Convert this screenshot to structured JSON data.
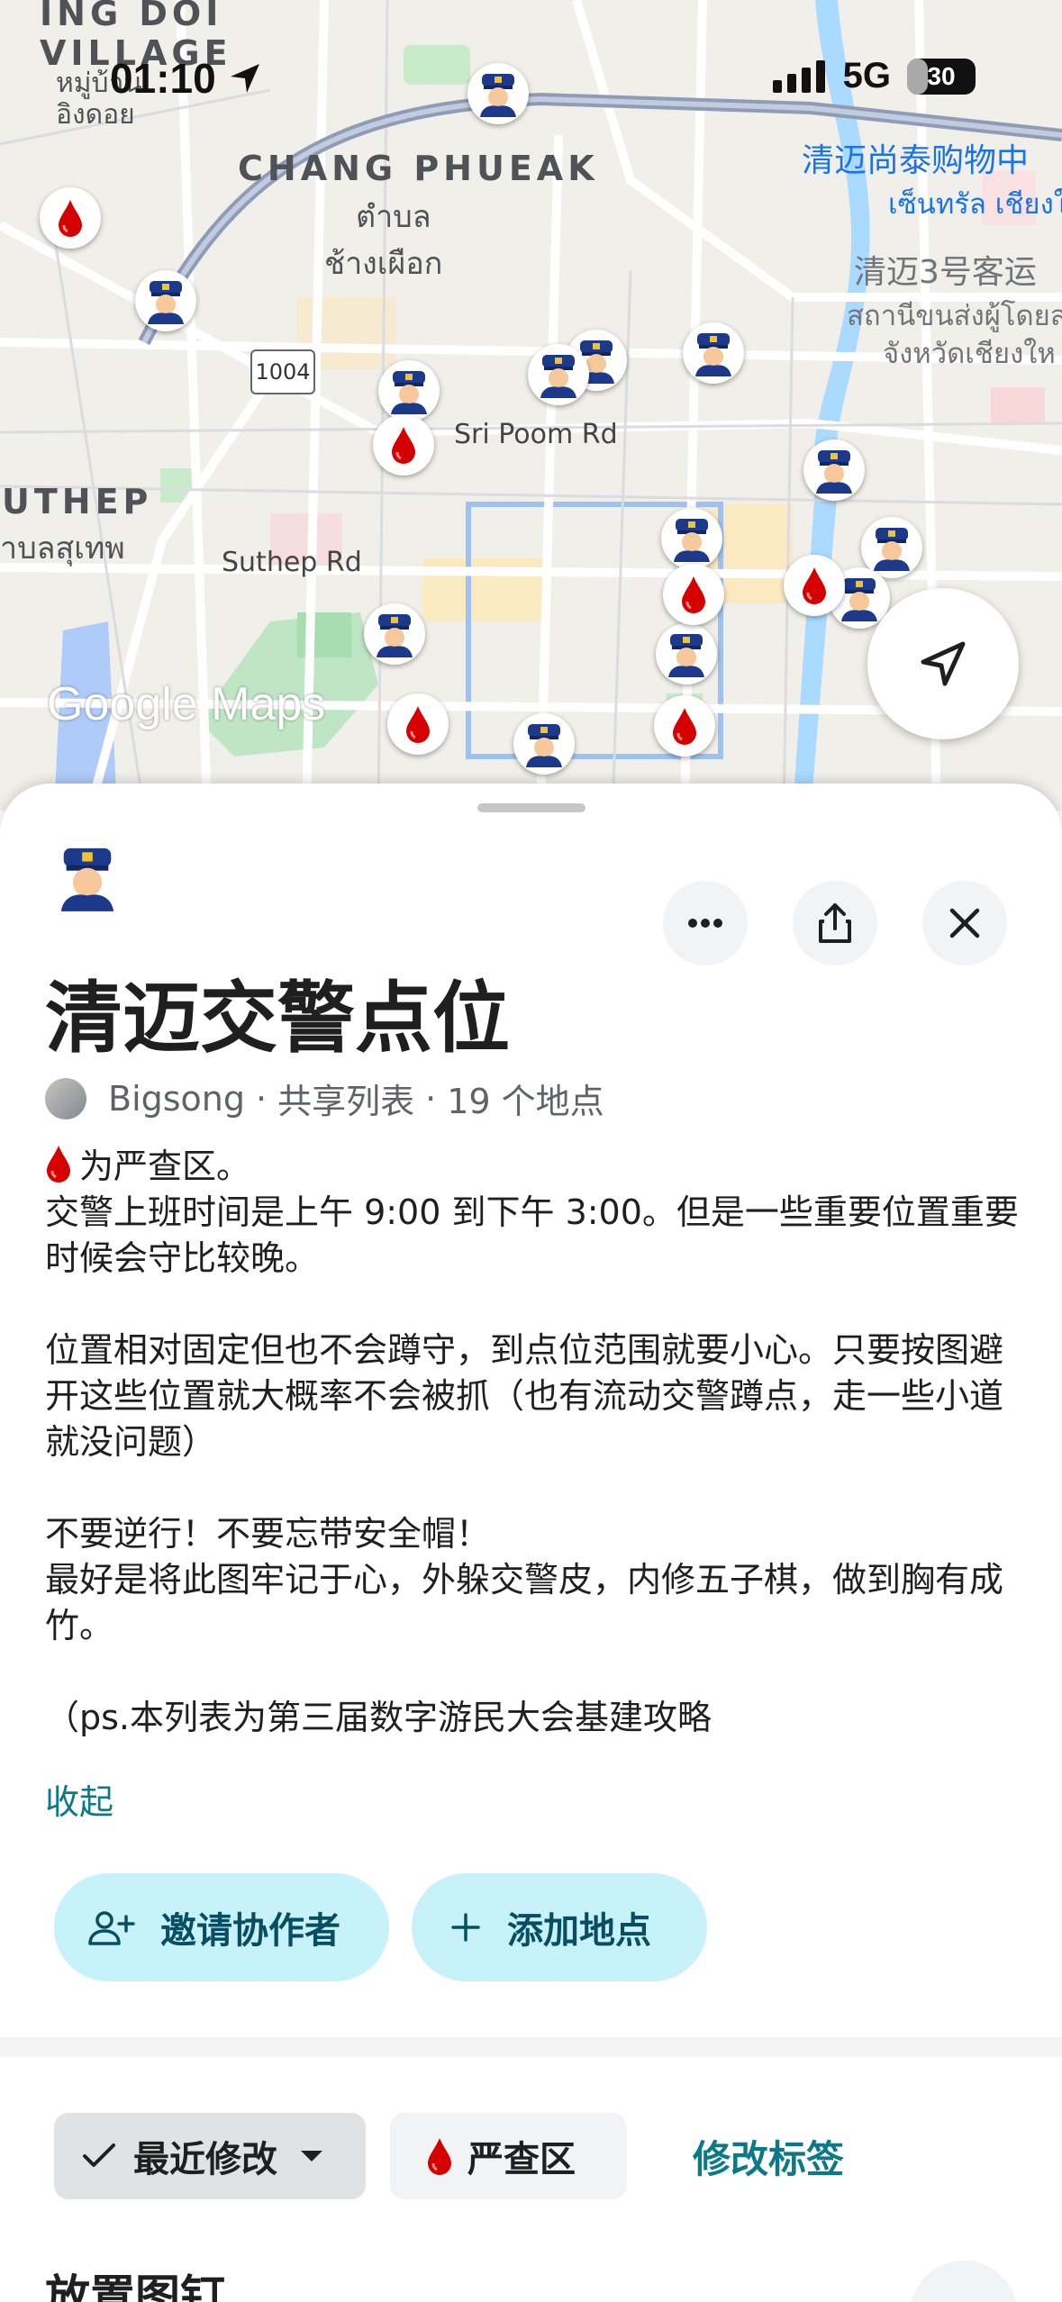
{
  "status_bar": {
    "time": "01:10",
    "network": "5G",
    "battery": "30",
    "battery_fraction": 0.3
  },
  "map": {
    "labels": {
      "village_en_1": "ING DOI",
      "village_en_2": "VILLAGE",
      "village_thai_1": "หมู่บ้าน",
      "village_thai_2": "อิงดอย",
      "district_chang_phueak": "CHANG PHUEAK",
      "chang_phueak_thai_1": "ตำบล",
      "chang_phueak_thai_2": "ช้างเผือก",
      "district_suthep": "UTHEP",
      "suthep_thai": "าบลสุเทพ",
      "road_sri_poom": "Sri Poom Rd",
      "road_suthep": "Suthep Rd",
      "route_number": "1004",
      "poi_central": "清迈尚泰购物中",
      "poi_central_thai": "เซ็นทรัล เชียงใ",
      "poi_bus": "清迈3号客运",
      "poi_bus_thai_1": "สถานีขนส่งผู้โดยส",
      "poi_bus_thai_2": "จังหวัดเชียงให"
    },
    "logo": "Google Maps",
    "marker_icons": [
      "police-officer-icon",
      "blood-drop-icon"
    ]
  },
  "sheet": {
    "list_icon": "police-officer-icon",
    "title": "清迈交警点位",
    "owner": "Bigsong",
    "list_type": "共享列表",
    "place_count": "19 个地点",
    "description": {
      "legend": "为严查区。",
      "line_1": "交警上班时间是上午 9:00 到下午 3:00。但是一些重要位置重要时候会守比较晚。",
      "line_2": "位置相对固定但也不会蹲守，到点位范围就要小心。只要按图避开这些位置就大概率不会被抓（也有流动交警蹲点，走一些小道就没问题）",
      "line_3": "不要逆行！不要忘带安全帽！",
      "line_4": "最好是将此图牢记于心，外躲交警皮，内修五子棋，做到胸有成竹。",
      "line_5": "（ps.本列表为第三届数字游民大会基建攻略"
    },
    "collapse_label": "收起",
    "invite_label": "邀请协作者",
    "add_place_label": "添加地点",
    "sort_label": "最近修改",
    "tag_label": "严查区",
    "edit_tags_label": "修改标签",
    "section_title": "放置图钉"
  },
  "colors": {
    "accent_teal": "#0b7a86",
    "pill_bg": "#c8f2fa",
    "drop_red": "#d50000",
    "poi_blue": "#1a73e8"
  }
}
